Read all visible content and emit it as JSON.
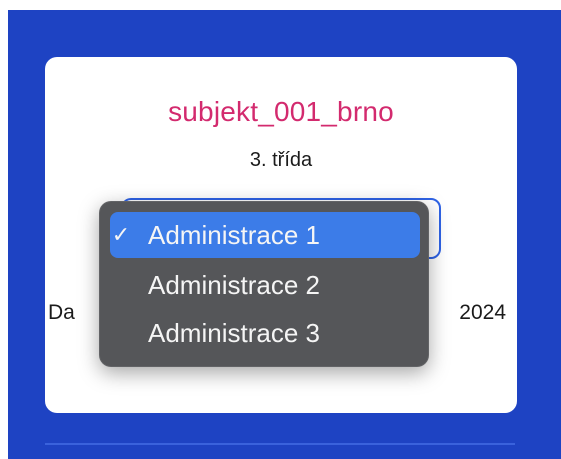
{
  "card": {
    "subject": "subjekt_001_brno",
    "grade": "3. třída",
    "date_left": "Da",
    "date_right": "2024"
  },
  "dropdown": {
    "options": [
      {
        "label": "Administrace 1",
        "selected": true
      },
      {
        "label": "Administrace 2",
        "selected": false
      },
      {
        "label": "Administrace 3",
        "selected": false
      }
    ],
    "check_mark": "✓"
  },
  "colors": {
    "panel_blue": "#1e43c3",
    "subject_pink": "#d32a6e",
    "select_border": "#2f63e6",
    "dropdown_bg": "#555659",
    "selected_bg": "#3c7ce8"
  }
}
